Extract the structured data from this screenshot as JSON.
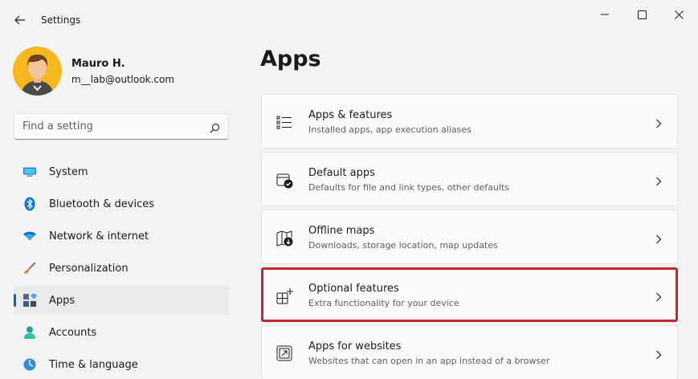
{
  "window": {
    "title": "Settings",
    "controls": {
      "minimize": "—",
      "maximize": "☐",
      "close": "✕"
    }
  },
  "profile": {
    "name": "Mauro H.",
    "email": "m__lab@outlook.com"
  },
  "search": {
    "placeholder": "Find a setting"
  },
  "sidebar": {
    "items": [
      {
        "label": "System",
        "icon": "system-icon",
        "active": false
      },
      {
        "label": "Bluetooth & devices",
        "icon": "bluetooth-icon",
        "active": false
      },
      {
        "label": "Network & internet",
        "icon": "wifi-icon",
        "active": false
      },
      {
        "label": "Personalization",
        "icon": "brush-icon",
        "active": false
      },
      {
        "label": "Apps",
        "icon": "apps-icon",
        "active": true
      },
      {
        "label": "Accounts",
        "icon": "person-icon",
        "active": false
      },
      {
        "label": "Time & language",
        "icon": "globe-icon",
        "active": false
      }
    ]
  },
  "main": {
    "title": "Apps",
    "cards": [
      {
        "title": "Apps & features",
        "subtitle": "Installed apps, app execution aliases",
        "icon": "list-icon"
      },
      {
        "title": "Default apps",
        "subtitle": "Defaults for file and link types, other defaults",
        "icon": "default-apps-icon"
      },
      {
        "title": "Offline maps",
        "subtitle": "Downloads, storage location, map updates",
        "icon": "map-download-icon"
      },
      {
        "title": "Optional features",
        "subtitle": "Extra functionality for your device",
        "icon": "grid-plus-icon",
        "highlighted": true
      },
      {
        "title": "Apps for websites",
        "subtitle": "Websites that can open in an app instead of a browser",
        "icon": "open-in-app-icon"
      }
    ]
  },
  "colors": {
    "accent": "#0067c0",
    "highlight": "#c4262e",
    "background": "#f3f3f3"
  }
}
